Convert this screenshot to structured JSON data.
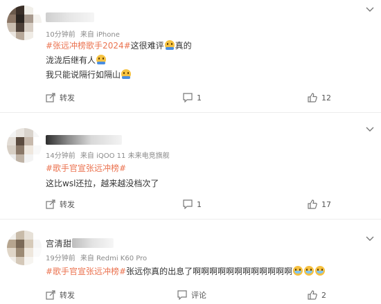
{
  "comments": [
    {
      "meta": {
        "time": "10分钟前",
        "source": "来自 iPhone"
      },
      "lines": [
        {
          "tag": "#张远冲榜歌手2024#",
          "text": "这很难评",
          "emoji_after_text": "hug-emoji",
          "tail": "真的"
        },
        {
          "text": "泷泷后继有人",
          "emoji_after_text": "hug-emoji"
        },
        {
          "text": "我只能说隔行如隔山",
          "emoji_after_text": "hug-emoji"
        }
      ],
      "actions": {
        "share": "转发",
        "comment": "1",
        "like": "12"
      }
    },
    {
      "meta": {
        "time": "14分钟前",
        "source": "来自 iQOO 11 未来电竞旗舰"
      },
      "lines": [
        {
          "tag": "#歌手官宣张远冲榜#"
        },
        {
          "text": "这比wsl还拉，越来越没档次了"
        }
      ],
      "actions": {
        "share": "转发",
        "comment": "1",
        "like": "17"
      }
    },
    {
      "name": "宫清甜",
      "meta": {
        "time": "19分钟前",
        "source": "来自 Redmi K60 Pro"
      },
      "lines": [
        {
          "tag": "#歌手官宣张远冲榜#",
          "text": "张远你真的出息了啊啊啊啊啊啊啊啊啊啊啊啊",
          "emojis": [
            "cry-emoji",
            "cry-emoji",
            "cry-emoji"
          ]
        }
      ],
      "actions": {
        "share": "转发",
        "comment": "评论",
        "like": "2"
      }
    }
  ],
  "colors": {
    "tag": "#eb7350",
    "meta": "#8a8a8a",
    "text": "#333333"
  },
  "icons": {
    "share": "share-icon",
    "comment": "comment-icon",
    "like": "like-icon",
    "menu": "chevron-down-icon"
  }
}
